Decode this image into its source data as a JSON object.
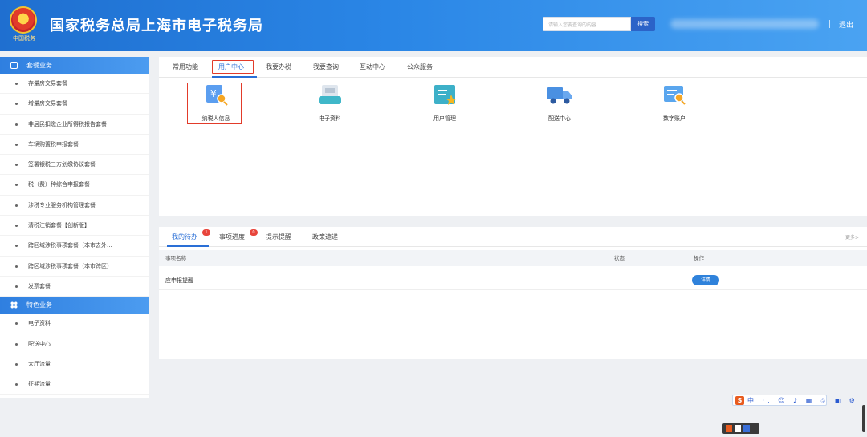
{
  "header": {
    "emblem_caption": "中国税务",
    "site_title": "国家税务总局上海市电子税务局",
    "search": {
      "placeholder": "请输入您要查询的内容",
      "button_label": "搜索"
    },
    "logout_label": "退出"
  },
  "sidebar": {
    "groups": [
      {
        "title": "套餐业务",
        "items": [
          "存量房交易套餐",
          "增量房交易套餐",
          "非居民扣缴企业所得税报告套餐",
          "车辆购置税申报套餐",
          "签署银税三方划缴协议套餐",
          "税（费）种综合申报套餐",
          "涉税专业服务机构管理套餐",
          "清税注销套餐【创新版】",
          "跨区域涉税事项套餐（本市去外...",
          "跨区域涉税事项套餐（本市跨区）",
          "发票套餐"
        ]
      },
      {
        "title": "特色业务",
        "items": [
          "电子资料",
          "配送中心",
          "大厅流量",
          "征期流量"
        ]
      }
    ]
  },
  "main": {
    "tabs": [
      "常用功能",
      "用户中心",
      "我要办税",
      "我要查询",
      "互动中心",
      "公众服务"
    ],
    "active_tab": "用户中心",
    "functions": [
      {
        "label": "纳税人信息",
        "icon": "taxpayer-info-icon"
      },
      {
        "label": "电子资料",
        "icon": "electronic-documents-icon"
      },
      {
        "label": "用户管理",
        "icon": "user-management-icon"
      },
      {
        "label": "配送中心",
        "icon": "delivery-truck-icon"
      },
      {
        "label": "数字账户",
        "icon": "digital-account-icon"
      }
    ],
    "bottom_tabs": [
      {
        "label": "我的待办",
        "badge": "1"
      },
      {
        "label": "事项进度",
        "badge": "0"
      },
      {
        "label": "提示提醒"
      },
      {
        "label": "政策速递"
      }
    ],
    "more_label": "更多>",
    "table": {
      "headers": [
        "事项名称",
        "状态",
        "操作"
      ],
      "rows": [
        {
          "name": "应申报提醒",
          "status": "",
          "action": "详情"
        }
      ]
    }
  },
  "ime": {
    "logo": "S",
    "text": "中 ·, ☺ ♪ ▦ ♧ ▣ ⚙"
  },
  "colors": {
    "header_blue": "#2a86e6",
    "accent": "#2a6fd6",
    "highlight_red": "#e23b2a",
    "badge_red": "#e8453c"
  }
}
